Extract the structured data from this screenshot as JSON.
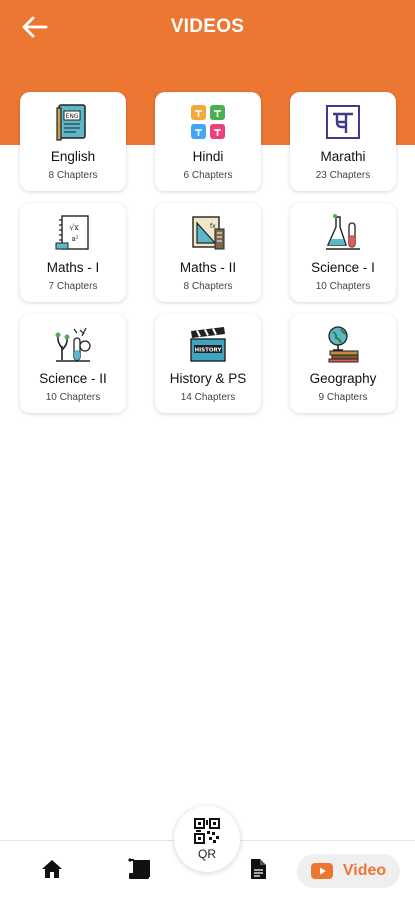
{
  "header": {
    "title": "VIDEOS",
    "back_icon": "back-arrow-icon",
    "color": "#ec7733"
  },
  "subjects": [
    {
      "title": "English",
      "chapters": "8 Chapters",
      "icon": "english-book-icon"
    },
    {
      "title": "Hindi",
      "chapters": "6 Chapters",
      "icon": "hindi-letters-icon"
    },
    {
      "title": "Marathi",
      "chapters": "23 Chapters",
      "icon": "marathi-letter-icon"
    },
    {
      "title": "Maths - I",
      "chapters": "7 Chapters",
      "icon": "maths-notebook-icon"
    },
    {
      "title": "Maths - II",
      "chapters": "8 Chapters",
      "icon": "geometry-tools-icon"
    },
    {
      "title": "Science - I",
      "chapters": "10 Chapters",
      "icon": "lab-flask-icon"
    },
    {
      "title": "Science - II",
      "chapters": "10 Chapters",
      "icon": "plant-science-icon"
    },
    {
      "title": "History & PS",
      "chapters": "14 Chapters",
      "icon": "history-clapper-icon"
    },
    {
      "title": "Geography",
      "chapters": "9 Chapters",
      "icon": "globe-books-icon"
    }
  ],
  "bottom_nav": {
    "home_icon": "home-icon",
    "notes_icon": "scroll-icon",
    "qr_label": "QR",
    "docs_icon": "document-icon",
    "video_label": "Video",
    "video_icon": "youtube-play-icon",
    "active_color": "#ec7733"
  }
}
